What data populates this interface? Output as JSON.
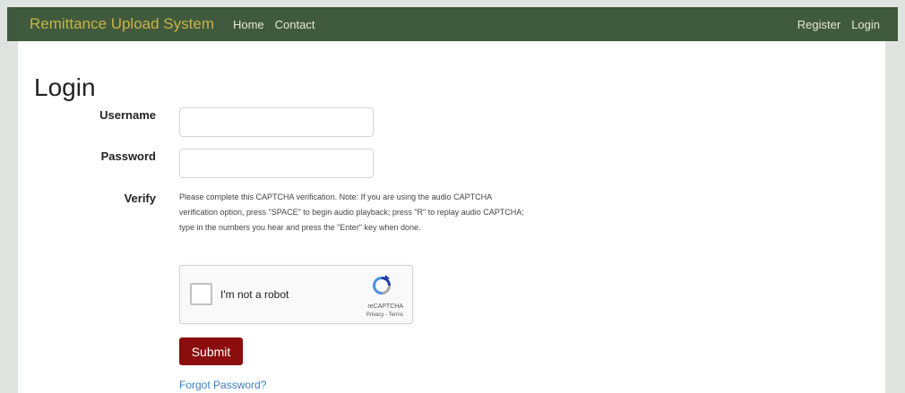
{
  "navbar": {
    "brand": "Remittance Upload System",
    "links": [
      "Home",
      "Contact"
    ],
    "right_links": [
      "Register",
      "Login"
    ]
  },
  "page": {
    "title": "Login"
  },
  "form": {
    "username_label": "Username",
    "username_value": "",
    "password_label": "Password",
    "password_value": "",
    "verify_label": "Verify",
    "verify_text": "Please complete this CAPTCHA verification. Note: If you are using the audio CAPTCHA verification option, press \"SPACE\" to begin audio playback; press \"R\" to replay audio CAPTCHA; type in the numbers you hear and press the \"Enter\" key when done.",
    "captcha": {
      "label": "I'm not a robot",
      "brand": "reCAPTCHA",
      "terms": "Privacy - Terms",
      "icon": "recaptcha-icon"
    },
    "submit_label": "Submit",
    "forgot_label": "Forgot Password?"
  },
  "colors": {
    "navbar_bg": "#3f5a3c",
    "brand": "#c9b34a",
    "submit_bg": "#8b0d0d",
    "link": "#3d7fc1"
  }
}
